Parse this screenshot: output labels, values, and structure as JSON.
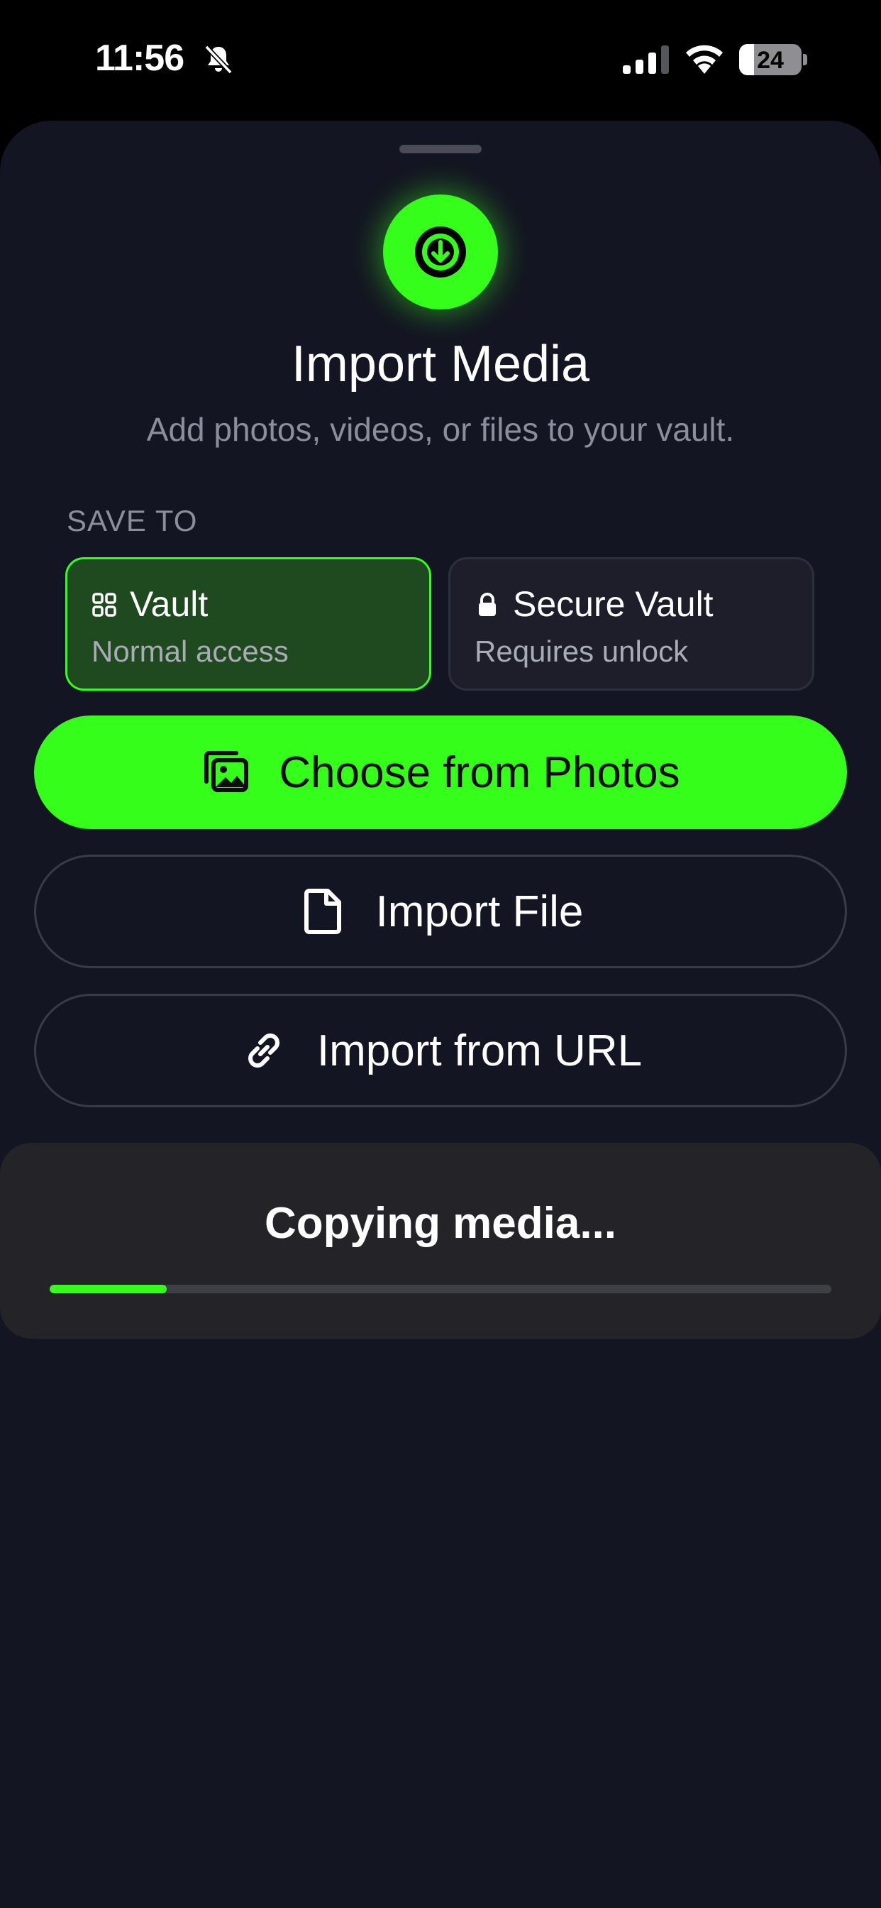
{
  "status_bar": {
    "time": "11:56",
    "battery_level": "24",
    "battery_fraction": 0.24,
    "icons": [
      "bell-slash-icon",
      "cellular-signal-icon",
      "wifi-icon",
      "battery-icon"
    ]
  },
  "sheet": {
    "hero_icon": "download-arrow-circle-icon",
    "title": "Import Media",
    "subtitle": "Add photos, videos, or files to your vault.",
    "save_to_label": "SAVE TO",
    "destinations": [
      {
        "icon": "grid-icon",
        "title": "Vault",
        "subtitle": "Normal access",
        "selected": true
      },
      {
        "icon": "lock-icon",
        "title": "Secure Vault",
        "subtitle": "Requires unlock",
        "selected": false
      }
    ],
    "actions": {
      "photos": {
        "icon": "photo-stack-icon",
        "label": "Choose from Photos"
      },
      "file": {
        "icon": "document-icon",
        "label": "Import File"
      },
      "url": {
        "icon": "link-icon",
        "label": "Import from URL"
      }
    }
  },
  "progress": {
    "title": "Copying media...",
    "fraction": 0.15
  },
  "colors": {
    "accent": "#35ff1a",
    "background": "#141522",
    "selected_card": "#1f4a1f",
    "panel": "#232328"
  }
}
